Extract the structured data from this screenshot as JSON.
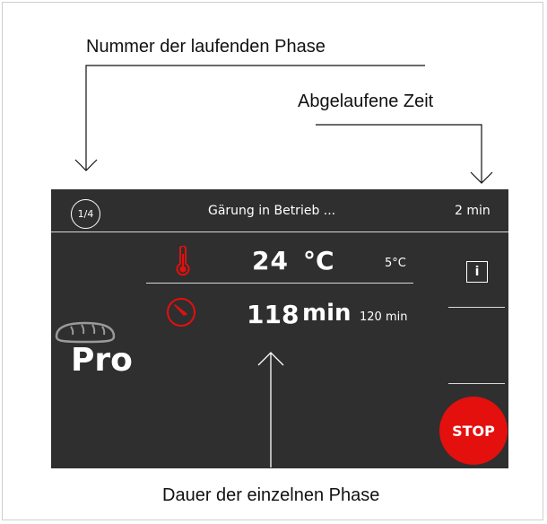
{
  "annotations": {
    "phase_number": "Nummer der laufenden Phase",
    "elapsed_time": "Abgelaufene Zeit",
    "phase_duration": "Dauer der einzelnen Phase"
  },
  "header": {
    "phase_indicator": "1/4",
    "status": "Gärung in Betrieb ...",
    "elapsed": "2 min"
  },
  "temperature": {
    "value": "24",
    "unit": "°C",
    "setpoint": "5°C"
  },
  "time": {
    "value": "118",
    "unit": "min",
    "total": "120 min"
  },
  "program": {
    "label": "Pro",
    "icon": "bread-icon"
  },
  "buttons": {
    "info": "i",
    "stop": "STOP"
  },
  "colors": {
    "panel_bg": "#2f2f2f",
    "accent_red": "#e3100e",
    "text": "#ffffff"
  }
}
